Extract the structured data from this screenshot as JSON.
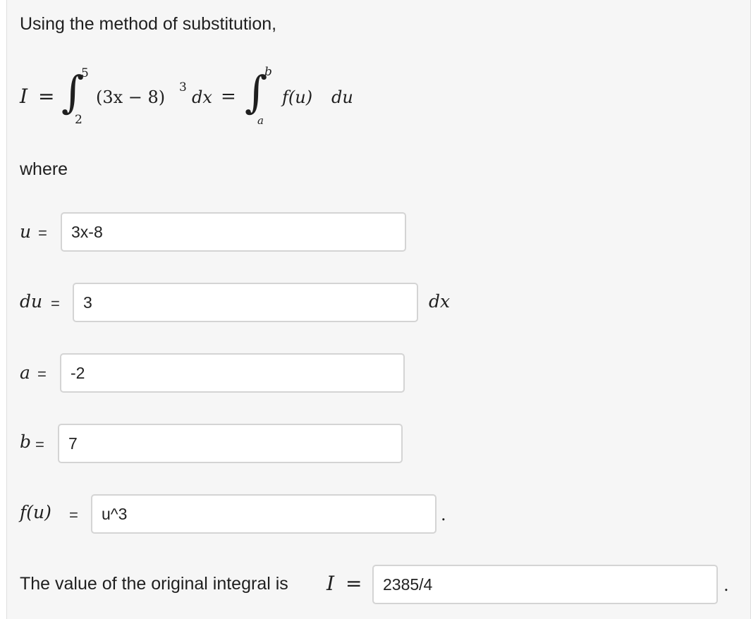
{
  "intro": "Using the method of substitution,",
  "formula": {
    "lhs": "I",
    "eq": "=",
    "int1_upper": "5",
    "int1_lower": "2",
    "integrand": "(3x − 8)",
    "power": "3",
    "dx": "dx",
    "eq2": "=",
    "int2_upper": "b",
    "int2_lower": "a",
    "f": "f(u)",
    "du": "du"
  },
  "where": "where",
  "fields": {
    "u": {
      "label": "u",
      "eq": "=",
      "value": "3x-8"
    },
    "du": {
      "label": "du",
      "eq": "=",
      "value": "3",
      "suffix": "dx"
    },
    "a": {
      "label": "a",
      "eq": "=",
      "value": "-2"
    },
    "b": {
      "label": "b",
      "eq": "=",
      "value": "7"
    },
    "f": {
      "label": "f(u)",
      "eq": "=",
      "value": "u^3",
      "suffix": "."
    }
  },
  "result": {
    "text": "The value of the original integral is",
    "var": "I",
    "eq": "=",
    "value": "2385/4",
    "suffix": "."
  }
}
